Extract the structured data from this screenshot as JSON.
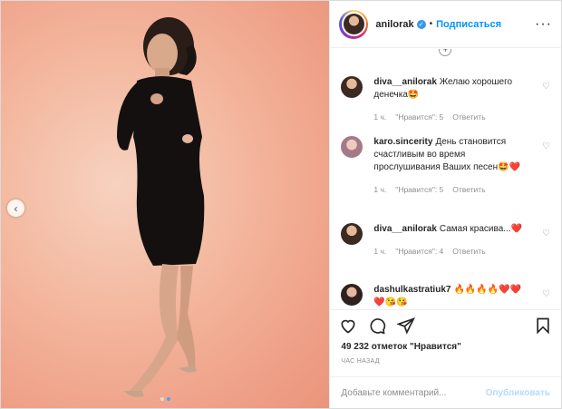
{
  "post": {
    "username": "anilorak",
    "separator": "•",
    "follow_label": "Подписаться",
    "more_label": "···",
    "likes_text": "49 232 отметок \"Нравится\"",
    "time_text": "ЧАС НАЗАД",
    "comment_placeholder": "Добавьте комментарий...",
    "publish_label": "Опубликовать",
    "carousel": {
      "slides": 2,
      "active": 2
    }
  },
  "comments": [
    {
      "user": "diva__anilorak",
      "text": "Желаю хорошего денечка🤩",
      "time": "1 ч.",
      "likes": "\"Нравится\": 5",
      "reply": "Ответить"
    },
    {
      "user": "karo.sincerity",
      "text": "День становится счастливым во время прослушивания Ваших песен🤩❤️",
      "time": "1 ч.",
      "likes": "\"Нравится\": 5",
      "reply": "Ответить"
    },
    {
      "user": "diva__anilorak",
      "text": "Самая красива...❤️",
      "time": "1 ч.",
      "likes": "\"Нравится\": 4",
      "reply": "Ответить"
    },
    {
      "user": "dashulkastratiuk7",
      "text": "🔥🔥🔥🔥❤️❤️❤️😘😘"
    }
  ],
  "icons": {
    "like": "heart-icon",
    "comment": "comment-icon",
    "share": "share-icon",
    "save": "bookmark-icon",
    "verified": "verified-badge-icon",
    "prev": "chevron-left-icon"
  },
  "colors": {
    "accent": "#0095f6",
    "publish_disabled": "#b3dbff",
    "muted": "#8e8e8e",
    "carousel_dot_active": "#4aa3ff"
  }
}
